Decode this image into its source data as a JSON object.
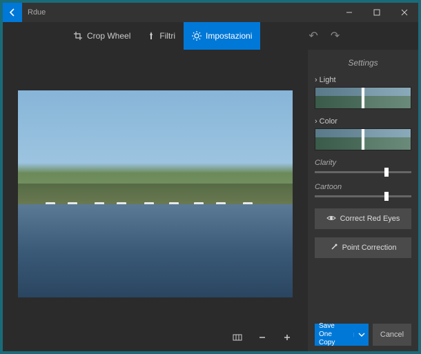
{
  "titlebar": {
    "back_label": "Rdue"
  },
  "toolbar": {
    "crop_label": "Crop Wheel",
    "filters_label": "Filtri",
    "settings_label": "Impostazioni"
  },
  "panel": {
    "title": "Settings",
    "light_label": "Light",
    "color_label": "Color",
    "clarity_label": "Clarity",
    "cartoon_label": "Cartoon",
    "redeye_label": "Correct Red Eyes",
    "point_label": "Point Correction",
    "clarity_value": 72,
    "cartoon_value": 72
  },
  "actions": {
    "save_line1": "Save One",
    "save_line2": "Copy",
    "cancel_label": "Cancel"
  }
}
